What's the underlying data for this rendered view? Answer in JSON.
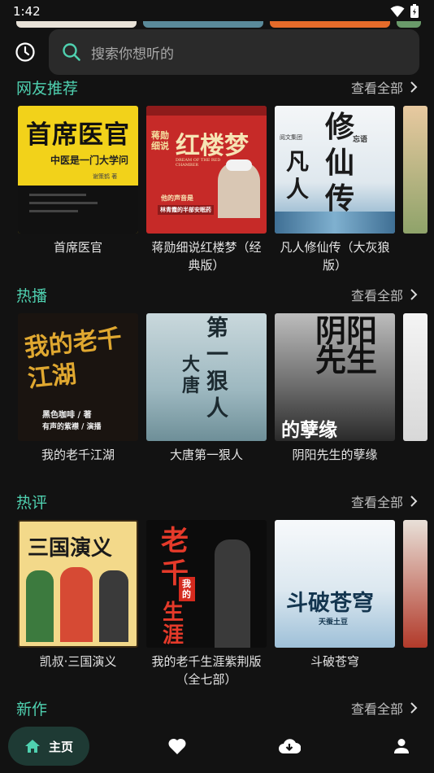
{
  "status": {
    "time": "1:42"
  },
  "search": {
    "placeholder": "搜索你想听的"
  },
  "sections": [
    {
      "title": "网友推荐",
      "see_all": "查看全部",
      "items": [
        {
          "title": "首席医官",
          "cover_text": "首席医官",
          "cover_sub": "中医是一门大学问",
          "cover_author": "谢策鹤 著"
        },
        {
          "title": "蒋勋细说红楼梦（经典版）",
          "cover_text": "红楼梦",
          "cover_side": "蒋勋细说",
          "cover_sub": "DREAM OF THE RED CHAMBER",
          "cover_band1": "他的声音是",
          "cover_band2": "林青霞的半部安眠药"
        },
        {
          "title": "凡人修仙传（大灰狼版）",
          "cover_text": "修仙传",
          "cover_left": "凡人",
          "cover_pub": "阅文集团",
          "cover_narrator": "忘语"
        }
      ]
    },
    {
      "title": "热播",
      "see_all": "查看全部",
      "items": [
        {
          "title": "我的老千江湖",
          "cover_text": "我的老千江湖",
          "cover_sub": "黑色咖啡 / 著",
          "cover_sub2": "有声的紫襟 / 演播"
        },
        {
          "title": "大唐第一狠人",
          "cover_text": "第一狠人",
          "cover_left": "大唐"
        },
        {
          "title": "阴阳先生的孽缘",
          "cover_text": "阴阳先生",
          "cover_bottom": "的孽缘"
        }
      ]
    },
    {
      "title": "热评",
      "see_all": "查看全部",
      "items": [
        {
          "title": "凯叔·三国演义",
          "cover_text": "三国演义"
        },
        {
          "title": "我的老千生涯紫荆版（全七部）",
          "cover_text": "老千",
          "cover_text2": "生涯",
          "cover_badge": "我的"
        },
        {
          "title": "斗破苍穹",
          "cover_text": "斗破苍穹",
          "cover_sub": "天蚕土豆"
        }
      ]
    },
    {
      "title": "新作",
      "see_all": "查看全部",
      "items": []
    }
  ],
  "nav": {
    "home_label": "主页"
  }
}
